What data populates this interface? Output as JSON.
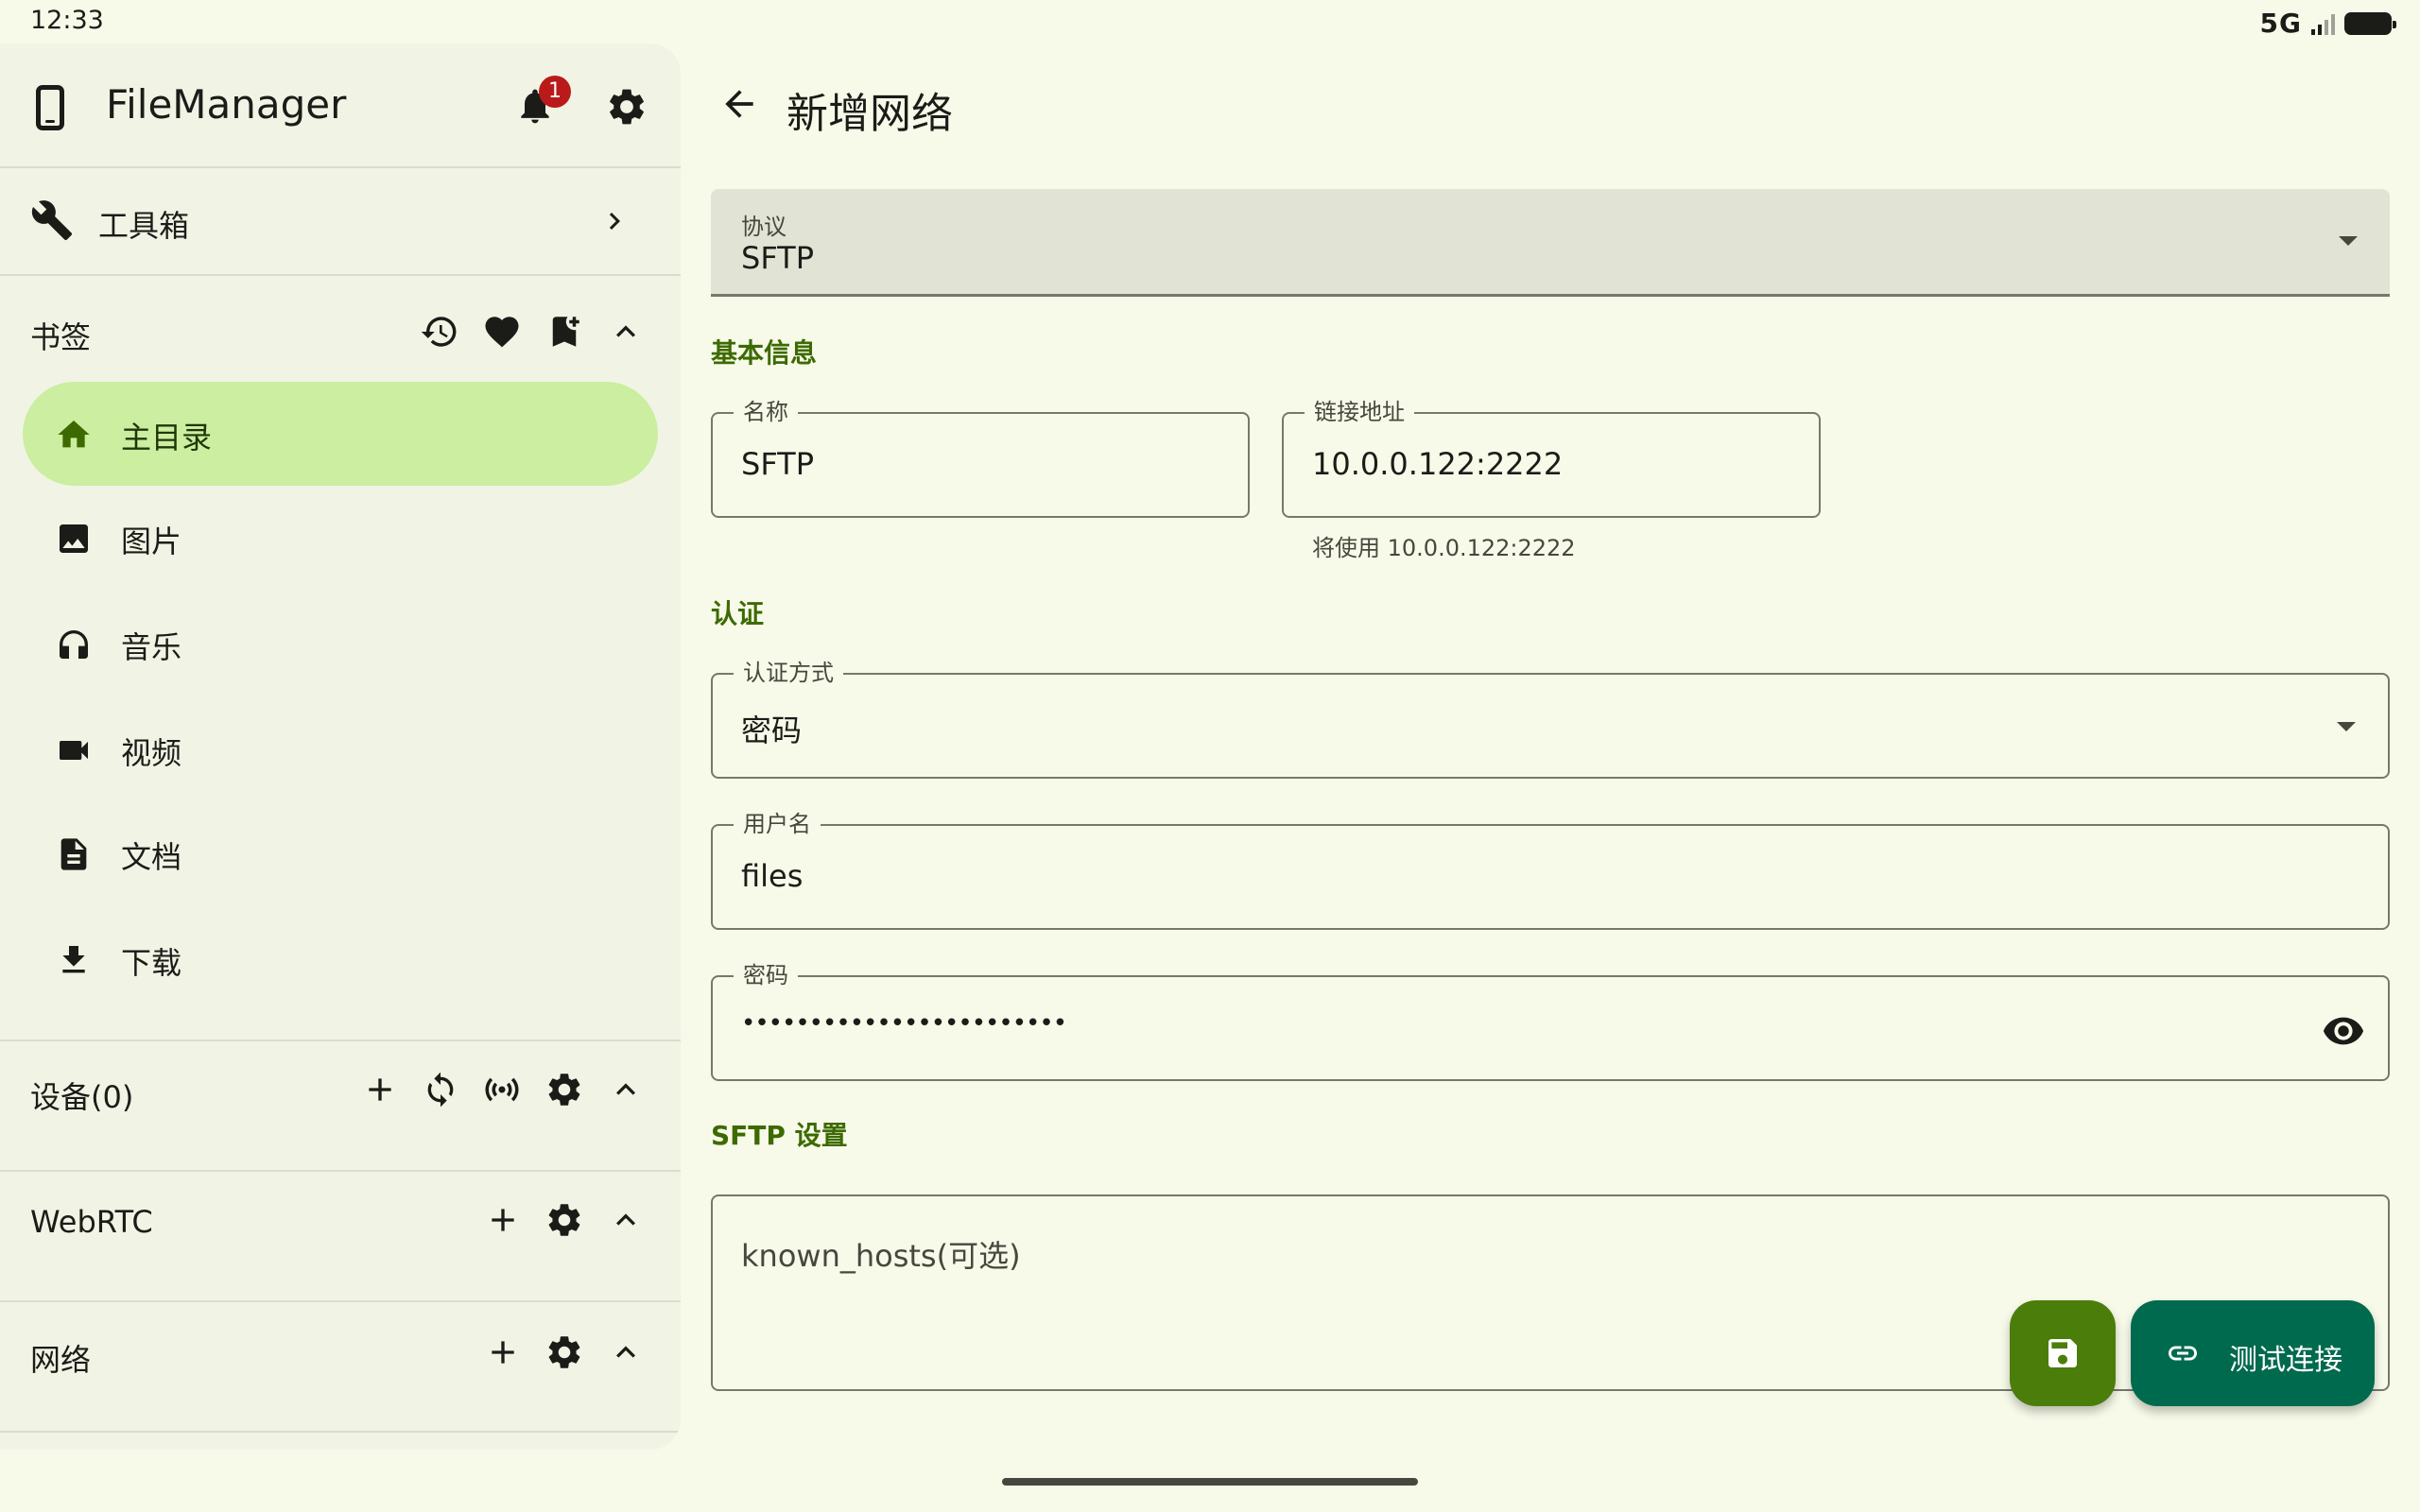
{
  "status_bar": {
    "time": "12:33",
    "network": "5G"
  },
  "sidebar": {
    "app_title": "FileManager",
    "notification_count": "1",
    "toolbox_label": "工具箱",
    "bookmarks": {
      "title": "书签",
      "items": [
        {
          "label": "主目录",
          "icon": "home-icon",
          "active": true
        },
        {
          "label": "图片",
          "icon": "image-icon"
        },
        {
          "label": "音乐",
          "icon": "headphones-icon"
        },
        {
          "label": "视频",
          "icon": "videocam-icon"
        },
        {
          "label": "文档",
          "icon": "document-icon"
        },
        {
          "label": "下载",
          "icon": "download-icon"
        }
      ]
    },
    "devices_title": "设备(0)",
    "webrtc_title": "WebRTC",
    "network_title": "网络"
  },
  "main": {
    "title": "新增网络",
    "protocol": {
      "label": "协议",
      "value": "SFTP"
    },
    "basic_info_title": "基本信息",
    "name_field": {
      "label": "名称",
      "value": "SFTP"
    },
    "address_field": {
      "label": "链接地址",
      "value": "10.0.0.122:2222",
      "helper": "将使用 10.0.0.122:2222"
    },
    "auth_title": "认证",
    "auth_method": {
      "label": "认证方式",
      "value": "密码"
    },
    "username": {
      "label": "用户名",
      "value": "files"
    },
    "password": {
      "label": "密码",
      "value": "••••••••••••••••••••••••"
    },
    "sftp_settings_title": "SFTP 设置",
    "known_hosts_placeholder": "known_hosts(可选)",
    "test_connection_label": "测试连接"
  },
  "colors": {
    "background": "#f7fae9",
    "sidebar": "#f1f4e5",
    "active_item": "#cbeea0",
    "accent_text": "#3d6a00",
    "save_fab": "#4b7d0b",
    "test_fab": "#006a4e",
    "badge": "#ba1a1a"
  }
}
